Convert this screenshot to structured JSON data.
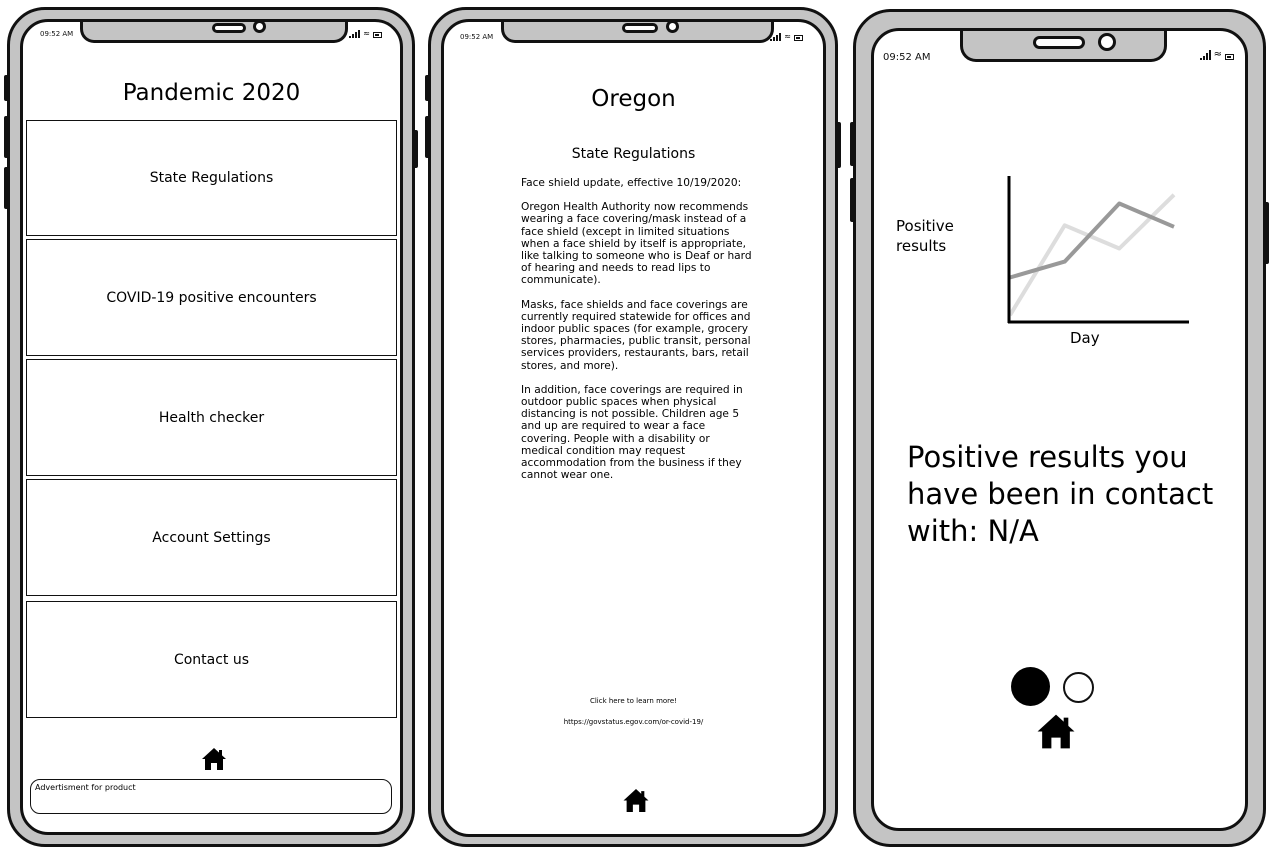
{
  "status_bar": {
    "time": "09:52 AM"
  },
  "phone1": {
    "title": "Pandemic 2020",
    "menu": [
      {
        "label": "State Regulations"
      },
      {
        "label": "COVID-19 positive encounters"
      },
      {
        "label": "Health checker"
      },
      {
        "label": "Account Settings"
      },
      {
        "label": "Contact us"
      }
    ],
    "home_icon": "home-icon",
    "ad_text": "Advertisment for product"
  },
  "phone2": {
    "title": "Oregon",
    "subtitle": "State Regulations",
    "paragraphs": [
      "Face shield update, effective 10/19/2020:",
      "Oregon Health Authority now recommends wearing a face covering/mask instead of a face shield (except in limited situations when a face shield by itself is appropriate, like talking to someone who is Deaf or hard of hearing and needs to read lips to communicate).",
      "Masks, face shields and face coverings are currently required statewide for offices and indoor public spaces (for example, grocery stores, pharmacies, public transit, personal services providers, restaurants, bars, retail stores, and more).",
      "In addition, face coverings are required in outdoor public spaces when physical distancing is not possible. Children age 5 and up are required to wear a face covering. People with a disability or medical condition may request accommodation from the business if they cannot wear one."
    ],
    "link_text": "Click here to learn more!",
    "link_url": "https://govstatus.egov.com/or-covid-19/",
    "home_icon": "home-icon"
  },
  "phone3": {
    "chart_ylabel": "Positive results",
    "chart_xlabel": "Day",
    "chart_data": {
      "type": "line",
      "xlabel": "Day",
      "ylabel": "Positive results",
      "axis_tick_labels": false,
      "series": [
        {
          "color": "#999999",
          "values": [
            0.3,
            0.41,
            0.81,
            0.65
          ]
        },
        {
          "color": "#dddddd",
          "values": [
            0.04,
            0.66,
            0.5,
            0.87
          ]
        }
      ]
    },
    "contact_text": "Positive results you have been in contact with: N/A",
    "pager": {
      "pages": 2,
      "current": 1
    },
    "home_icon": "home-icon"
  },
  "colors": {
    "frame": "#c4c4c4",
    "outline": "#111111",
    "line_dark": "#999999",
    "line_light": "#dddddd"
  }
}
